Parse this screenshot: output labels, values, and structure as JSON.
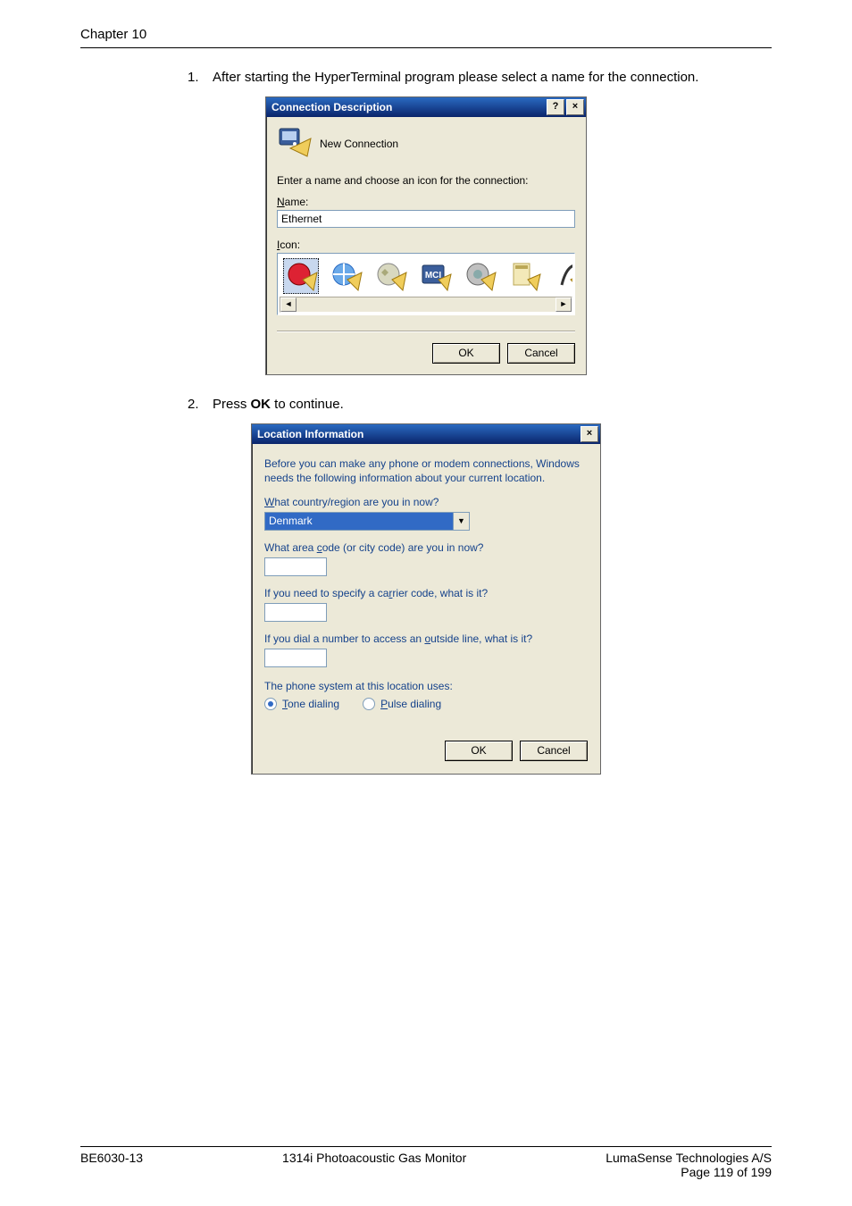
{
  "header": {
    "chapter": "Chapter 10"
  },
  "steps": {
    "s1_num": "1.",
    "s1_text": "After starting the HyperTerminal program please select a name for the connection.",
    "s2_num": "2.",
    "s2_text_prefix": "Press ",
    "s2_text_bold": "OK",
    "s2_text_suffix": " to continue."
  },
  "dialog1": {
    "title": "Connection Description",
    "help_btn": "?",
    "close_btn": "×",
    "new_connection": "New Connection",
    "enter_name_label": "Enter a name and choose an icon for the connection:",
    "name_label_underline": "N",
    "name_label_rest": "ame:",
    "name_value": "Ethernet",
    "icon_label_underline": "I",
    "icon_label_rest": "con:",
    "scroll_left": "◄",
    "scroll_right": "►",
    "ok": "OK",
    "cancel": "Cancel"
  },
  "dialog2": {
    "title": "Location Information",
    "close_btn": "×",
    "intro": "Before you can make any phone or modem connections, Windows needs the following information about your current location.",
    "country_label_underline": "W",
    "country_label_rest": "hat country/region are you in now?",
    "country_value": "Denmark",
    "area_label_pre": "What area ",
    "area_label_underline": "c",
    "area_label_post": "ode (or city code) are you in now?",
    "carrier_label_pre": "If you need to specify a ca",
    "carrier_label_underline": "r",
    "carrier_label_post": "rier code, what is it?",
    "outside_label_pre": "If you dial a number to access an ",
    "outside_label_underline": "o",
    "outside_label_post": "utside line, what is it?",
    "phone_system_label": "The phone system at this location uses:",
    "tone_underline": "T",
    "tone_rest": "one dialing",
    "pulse_underline": "P",
    "pulse_rest": "ulse dialing",
    "ok": "OK",
    "cancel": "Cancel"
  },
  "footer": {
    "left": "BE6030-13",
    "center": "1314i Photoacoustic Gas Monitor",
    "right_line1": "LumaSense Technologies A/S",
    "right_line2": "Page 119 of 199"
  }
}
